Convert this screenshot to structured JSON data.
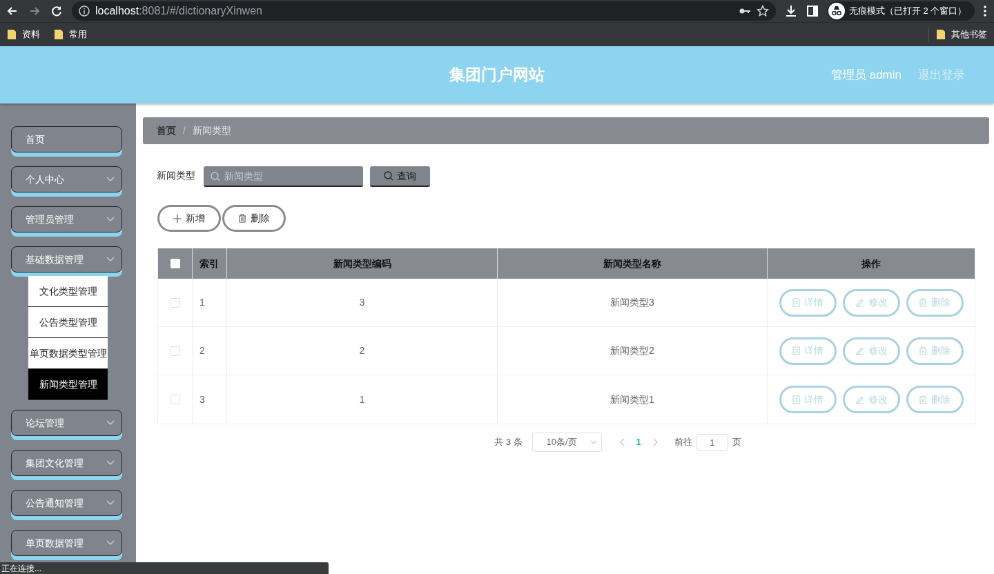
{
  "browser": {
    "url_host": "localhost",
    "url_rest": ":8081/#/dictionaryXinwen",
    "bookmarks": [
      "资料",
      "常用"
    ],
    "incognito": "无痕模式（已打开 2 个窗口）",
    "other_bookmarks": "其他书签"
  },
  "header": {
    "title": "集团门户网站",
    "user": "管理员 admin",
    "logout": "退出登录"
  },
  "sidebar": {
    "items": [
      {
        "label": "首页",
        "has_arrow": false
      },
      {
        "label": "个人中心",
        "has_arrow": true
      },
      {
        "label": "管理员管理",
        "has_arrow": true
      },
      {
        "label": "基础数据管理",
        "has_arrow": true,
        "children": [
          {
            "label": "文化类型管理",
            "selected": false
          },
          {
            "label": "公告类型管理",
            "selected": false
          },
          {
            "label": "单页数据类型管理",
            "selected": false
          },
          {
            "label": "新闻类型管理",
            "selected": true
          }
        ]
      },
      {
        "label": "论坛管理",
        "has_arrow": true
      },
      {
        "label": "集团文化管理",
        "has_arrow": true
      },
      {
        "label": "公告通知管理",
        "has_arrow": true
      },
      {
        "label": "单页数据管理",
        "has_arrow": true
      }
    ]
  },
  "breadcrumb": {
    "items": [
      "首页",
      "新闻类型"
    ],
    "separator": "/"
  },
  "search": {
    "label": "新闻类型",
    "placeholder": "新闻类型",
    "button": "查询"
  },
  "actions": [
    {
      "kind": "add",
      "label": "新增"
    },
    {
      "kind": "delete",
      "label": "删除"
    }
  ],
  "table": {
    "columns": [
      "索引",
      "新闻类型编码",
      "新闻类型名称",
      "操作"
    ],
    "rows": [
      {
        "index": "1",
        "code": "3",
        "name": "新闻类型3",
        "checked": false,
        "actions": [
          {
            "kind": "detail",
            "label": "详情"
          },
          {
            "kind": "edit",
            "label": "修改"
          },
          {
            "kind": "delete",
            "label": "删除"
          }
        ]
      },
      {
        "index": "2",
        "code": "2",
        "name": "新闻类型2",
        "checked": false,
        "actions": [
          {
            "kind": "detail",
            "label": "详情"
          },
          {
            "kind": "edit",
            "label": "修改"
          },
          {
            "kind": "delete",
            "label": "删除"
          }
        ]
      },
      {
        "index": "3",
        "code": "1",
        "name": "新闻类型1",
        "checked": false,
        "actions": [
          {
            "kind": "detail",
            "label": "详情"
          },
          {
            "kind": "edit",
            "label": "修改"
          },
          {
            "kind": "delete",
            "label": "删除"
          }
        ]
      }
    ],
    "header_checked": false
  },
  "pagination": {
    "total": "共 3 条",
    "page_size": "10条/页",
    "pages": [
      {
        "label": "1",
        "selected": true
      }
    ],
    "goto_label": "前往",
    "goto_value": "1",
    "goto_suffix": "页"
  },
  "status_bar": "正在连接..."
}
